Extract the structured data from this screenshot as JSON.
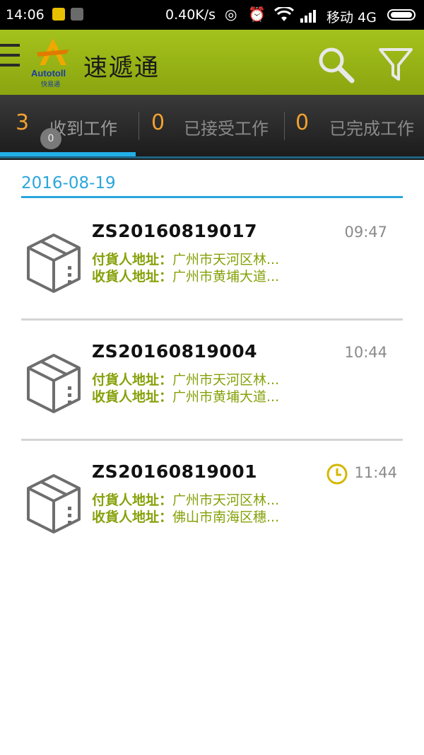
{
  "status_bar": {
    "time": "14:06",
    "speed": "0.40K/s",
    "carrier": "移动 4G"
  },
  "app": {
    "title": "速遞通",
    "logo_text": "Autotoll",
    "logo_subtext": "快易通",
    "accent_color": "#9bb816",
    "tab_accent_color": "#23aee8"
  },
  "tabs": [
    {
      "count": "3",
      "label": "收到工作",
      "badge": "0",
      "active": true
    },
    {
      "count": "0",
      "label": "已接受工作"
    },
    {
      "count": "0",
      "label": "已完成工作"
    }
  ],
  "list": {
    "date": "2016-08-19",
    "items": [
      {
        "order_no": "ZS20160819017",
        "time": "09:47",
        "shipper_label": "付貨人地址：",
        "shipper_addr": "广州市天河区林...",
        "receiver_label": "收貨人地址：",
        "receiver_addr": "广州市黄埔大道...",
        "icon": "package-icon"
      },
      {
        "order_no": "ZS20160819004",
        "time": "10:44",
        "shipper_label": "付貨人地址：",
        "shipper_addr": "广州市天河区林...",
        "receiver_label": "收貨人地址：",
        "receiver_addr": "广州市黄埔大道...",
        "icon": "package-icon"
      },
      {
        "order_no": "ZS20160819001",
        "time": "11:44",
        "shipper_label": "付貨人地址：",
        "shipper_addr": "广州市天河区林...",
        "receiver_label": "收貨人地址：",
        "receiver_addr": "佛山市南海区穗...",
        "icon": "package-icon",
        "status_icon": "clock-icon"
      }
    ]
  }
}
